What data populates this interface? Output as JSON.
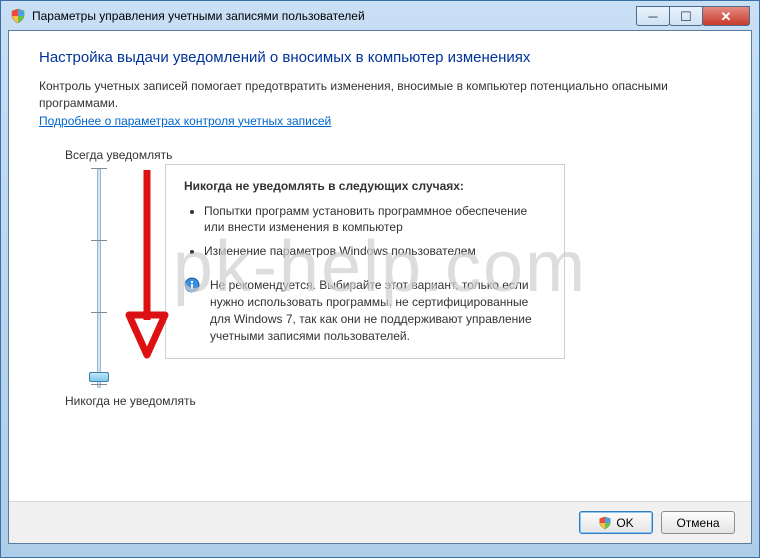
{
  "titlebar": {
    "title": "Параметры управления учетными записями пользователей"
  },
  "page": {
    "heading": "Настройка выдачи уведомлений о вносимых в компьютер изменениях",
    "description": "Контроль учетных записей помогает предотвратить изменения, вносимые в компьютер потенциально опасными программами.",
    "link": "Подробнее о параметрах контроля учетных записей"
  },
  "slider": {
    "top_label": "Всегда уведомлять",
    "bottom_label": "Никогда не уведомлять"
  },
  "panel": {
    "heading": "Никогда не уведомлять в следующих случаях:",
    "bullet1": "Попытки программ установить программное обеспечение или внести изменения в компьютер",
    "bullet2": "Изменение параметров Windows пользователем",
    "info": "Не рекомендуется. Выбирайте этот вариант, только если нужно использовать программы, не сертифицированные для Windows 7, так как они не поддерживают управление учетными записями пользователей."
  },
  "footer": {
    "ok": "OK",
    "cancel": "Отмена"
  },
  "watermark": "pk-help.com"
}
